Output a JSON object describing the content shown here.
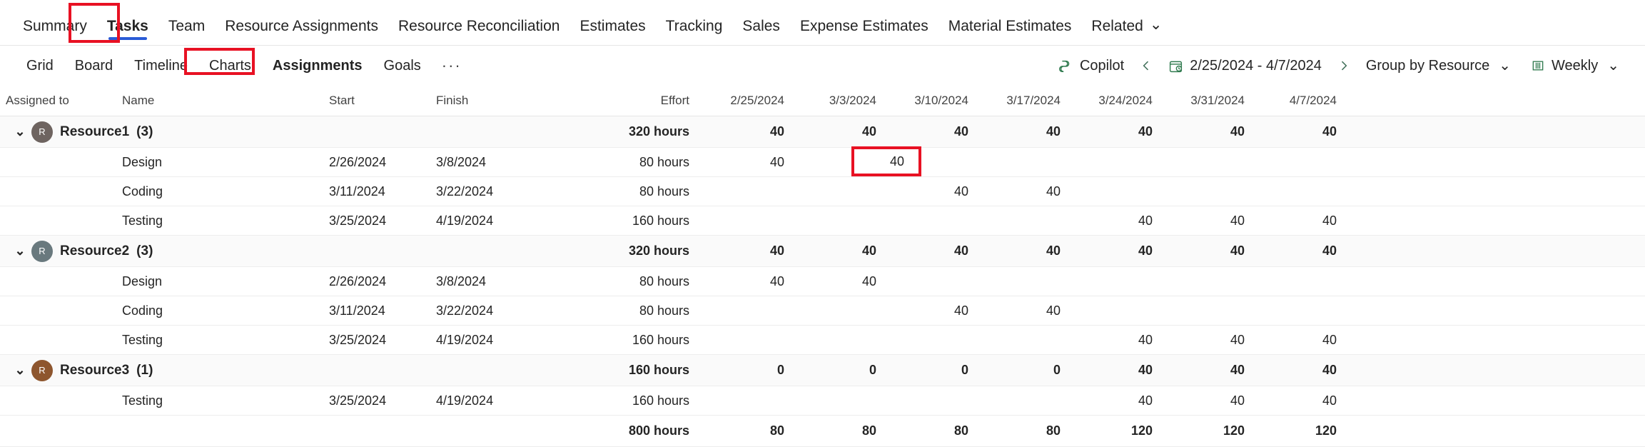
{
  "primary_nav": {
    "items": [
      {
        "label": "Summary",
        "selected": false
      },
      {
        "label": "Tasks",
        "selected": true
      },
      {
        "label": "Team",
        "selected": false
      },
      {
        "label": "Resource Assignments",
        "selected": false
      },
      {
        "label": "Resource Reconciliation",
        "selected": false
      },
      {
        "label": "Estimates",
        "selected": false
      },
      {
        "label": "Tracking",
        "selected": false
      },
      {
        "label": "Sales",
        "selected": false
      },
      {
        "label": "Expense Estimates",
        "selected": false
      },
      {
        "label": "Material Estimates",
        "selected": false
      },
      {
        "label": "Related",
        "selected": false,
        "caret": "⌄"
      }
    ]
  },
  "secondary_tabs": {
    "items": [
      {
        "label": "Grid",
        "selected": false
      },
      {
        "label": "Board",
        "selected": false
      },
      {
        "label": "Timeline",
        "selected": false
      },
      {
        "label": "Charts",
        "selected": false
      },
      {
        "label": "Assignments",
        "selected": true
      },
      {
        "label": "Goals",
        "selected": false
      }
    ],
    "overflow_label": "···"
  },
  "toolbar": {
    "copilot_label": "Copilot",
    "prev_label": "‹",
    "next_label": "›",
    "date_range": "2/25/2024 - 4/7/2024",
    "group_by_label": "Group by Resource",
    "group_by_caret": "⌄",
    "period_label": "Weekly",
    "period_caret": "⌄"
  },
  "grid": {
    "columns": {
      "assigned_to": "Assigned to",
      "name": "Name",
      "start": "Start",
      "finish": "Finish",
      "effort": "Effort"
    },
    "week_columns": [
      "2/25/2024",
      "3/3/2024",
      "3/10/2024",
      "3/17/2024",
      "3/24/2024",
      "3/31/2024",
      "4/7/2024"
    ],
    "groups": [
      {
        "name": "Resource1",
        "count": "(3)",
        "avatar_initial": "R",
        "avatar_color": "#6e6460",
        "chevron": "⌄",
        "effort": "320 hours",
        "weeks": [
          "40",
          "40",
          "40",
          "40",
          "40",
          "40",
          "40"
        ],
        "tasks": [
          {
            "name": "Design",
            "start": "2/26/2024",
            "finish": "3/8/2024",
            "effort": "80 hours",
            "weeks": [
              "40",
              "40",
              "",
              "",
              "",
              "",
              ""
            ]
          },
          {
            "name": "Coding",
            "start": "3/11/2024",
            "finish": "3/22/2024",
            "effort": "80 hours",
            "weeks": [
              "",
              "",
              "40",
              "40",
              "",
              "",
              ""
            ]
          },
          {
            "name": "Testing",
            "start": "3/25/2024",
            "finish": "4/19/2024",
            "effort": "160 hours",
            "weeks": [
              "",
              "",
              "",
              "",
              "40",
              "40",
              "40"
            ]
          }
        ]
      },
      {
        "name": "Resource2",
        "count": "(3)",
        "avatar_initial": "R",
        "avatar_color": "#69797e",
        "chevron": "⌄",
        "effort": "320 hours",
        "weeks": [
          "40",
          "40",
          "40",
          "40",
          "40",
          "40",
          "40"
        ],
        "tasks": [
          {
            "name": "Design",
            "start": "2/26/2024",
            "finish": "3/8/2024",
            "effort": "80 hours",
            "weeks": [
              "40",
              "40",
              "",
              "",
              "",
              "",
              ""
            ]
          },
          {
            "name": "Coding",
            "start": "3/11/2024",
            "finish": "3/22/2024",
            "effort": "80 hours",
            "weeks": [
              "",
              "",
              "40",
              "40",
              "",
              "",
              ""
            ]
          },
          {
            "name": "Testing",
            "start": "3/25/2024",
            "finish": "4/19/2024",
            "effort": "160 hours",
            "weeks": [
              "",
              "",
              "",
              "",
              "40",
              "40",
              "40"
            ]
          }
        ]
      },
      {
        "name": "Resource3",
        "count": "(1)",
        "avatar_initial": "R",
        "avatar_color": "#8e562e",
        "chevron": "⌄",
        "effort": "160 hours",
        "weeks": [
          "0",
          "0",
          "0",
          "0",
          "40",
          "40",
          "40"
        ],
        "tasks": [
          {
            "name": "Testing",
            "start": "3/25/2024",
            "finish": "4/19/2024",
            "effort": "160 hours",
            "weeks": [
              "",
              "",
              "",
              "",
              "40",
              "40",
              "40"
            ]
          }
        ]
      }
    ],
    "total_row": {
      "effort": "800 hours",
      "weeks": [
        "80",
        "80",
        "80",
        "80",
        "120",
        "120",
        "120"
      ]
    }
  },
  "annotations": {
    "highlight_color": "#e81123",
    "boxes": [
      "tasks-tab",
      "assignments-tab",
      "design-week-3-3-2024-cell"
    ],
    "highlighted_cell_value": "40"
  }
}
